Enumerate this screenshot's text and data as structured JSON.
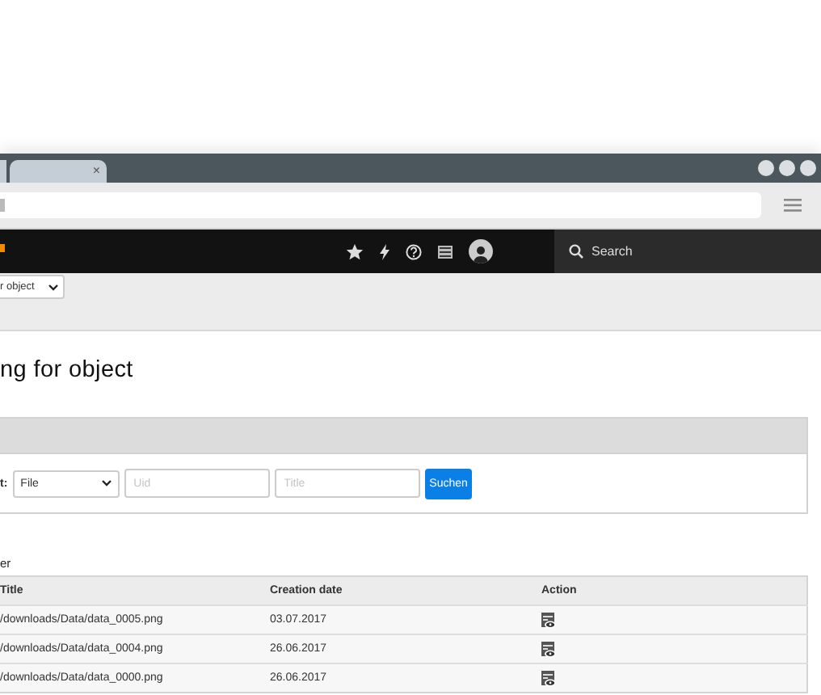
{
  "browser": {
    "tab_close": "×"
  },
  "nav": {
    "search": {
      "placeholder": "Search"
    }
  },
  "toolbar": {
    "object_select": {
      "value": "r object"
    }
  },
  "heading": "ng for object",
  "search_form": {
    "label": "t:",
    "type_select": {
      "value": "File"
    },
    "uid": {
      "placeholder": "Uid"
    },
    "title": {
      "placeholder": "Title"
    },
    "button": "Suchen"
  },
  "results_label": "er",
  "table": {
    "columns": [
      "Title",
      "Creation date",
      "Action"
    ],
    "rows": [
      {
        "title": "/downloads/Data/data_0005.png",
        "creation_date": "03.07.2017"
      },
      {
        "title": "/downloads/Data/data_0004.png",
        "creation_date": "26.06.2017"
      },
      {
        "title": "/downloads/Data/data_0000.png",
        "creation_date": "26.06.2017"
      }
    ]
  }
}
